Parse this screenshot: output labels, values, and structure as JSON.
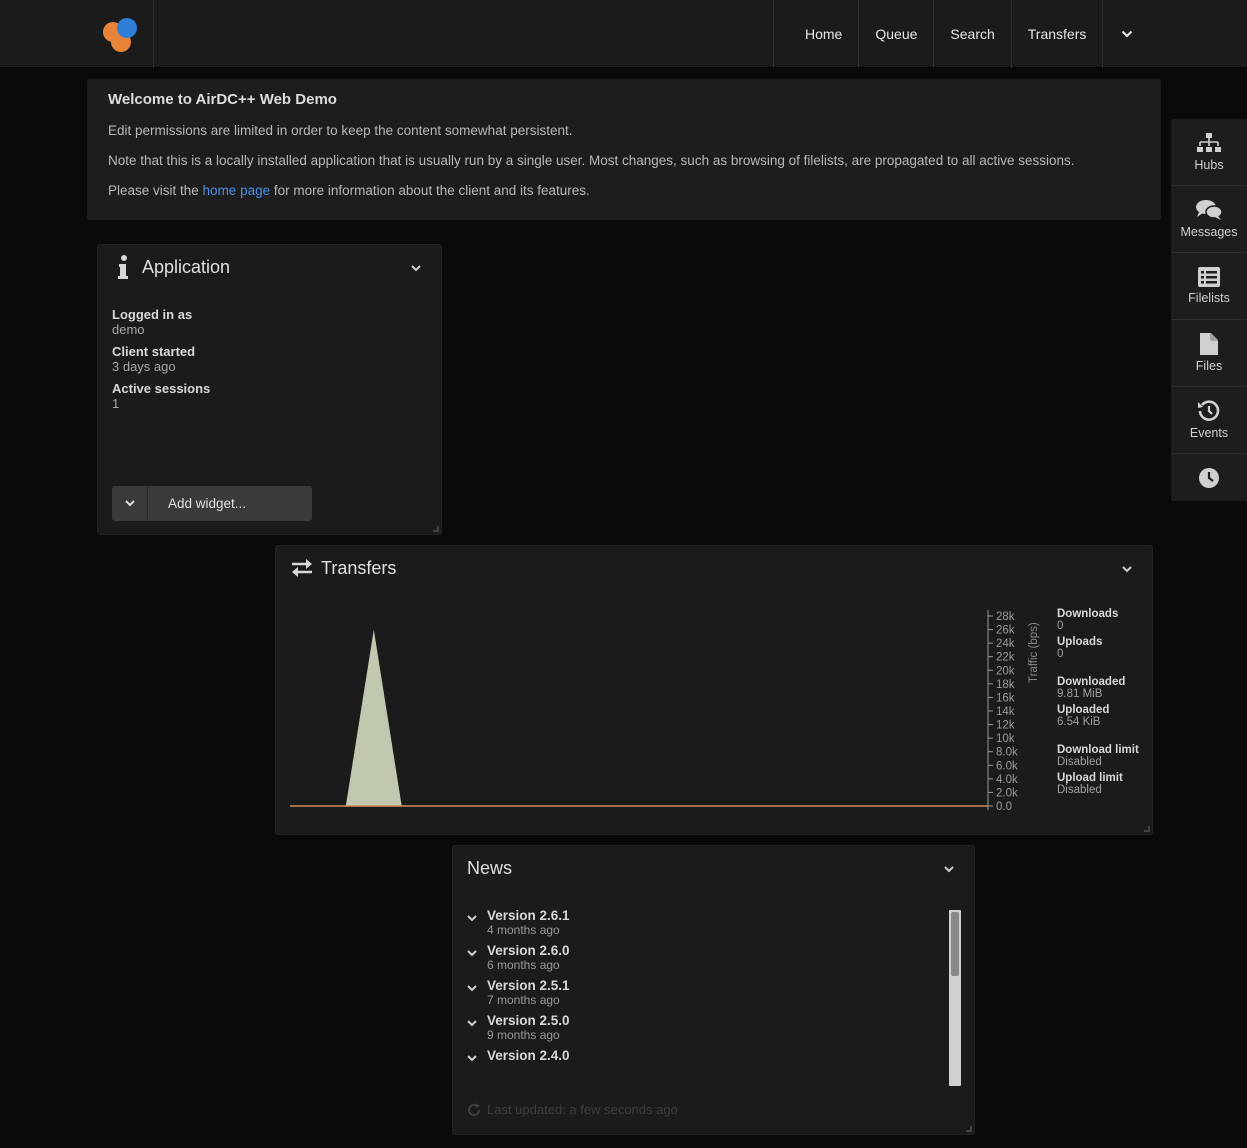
{
  "nav": {
    "items": [
      "Home",
      "Queue",
      "Search",
      "Transfers"
    ]
  },
  "welcome": {
    "title": "Welcome to AirDC++ Web Demo",
    "line1": "Edit permissions are limited in order to keep the content somewhat persistent.",
    "line2": "Note that this is a locally installed application that is usually run by a single user. Most changes, such as browsing of filelists, are propagated to all active sessions.",
    "line3_pre": "Please visit the ",
    "line3_link": "home page",
    "line3_post": " for more information about the client and its features."
  },
  "sidebar": {
    "items": [
      {
        "label": "Hubs",
        "icon": "sitemap-icon"
      },
      {
        "label": "Messages",
        "icon": "comments-icon"
      },
      {
        "label": "Filelists",
        "icon": "list-icon"
      },
      {
        "label": "Files",
        "icon": "file-icon"
      },
      {
        "label": "Events",
        "icon": "history-icon"
      },
      {
        "label": "",
        "icon": "clock-icon"
      }
    ]
  },
  "application": {
    "title": "Application",
    "logged_in_label": "Logged in as",
    "logged_in_value": "demo",
    "client_started_label": "Client started",
    "client_started_value": "3 days ago",
    "active_sessions_label": "Active sessions",
    "active_sessions_value": "1",
    "add_widget_label": "Add widget..."
  },
  "transfers": {
    "title": "Transfers",
    "stats": [
      {
        "label": "Downloads",
        "value": "0"
      },
      {
        "label": "Uploads",
        "value": "0"
      },
      {
        "label": "Downloaded",
        "value": "9.81 MiB"
      },
      {
        "label": "Uploaded",
        "value": "6.54 KiB"
      },
      {
        "label": "Download limit",
        "value": "Disabled"
      },
      {
        "label": "Upload limit",
        "value": "Disabled"
      }
    ]
  },
  "chart_data": {
    "type": "area",
    "ylabel": "Traffic (bps)",
    "ylim": [
      0,
      28000
    ],
    "yticks": [
      "0.0",
      "2.0k",
      "4.0k",
      "6.0k",
      "8.0k",
      "10k",
      "12k",
      "14k",
      "16k",
      "18k",
      "20k",
      "22k",
      "24k",
      "26k",
      "28k"
    ],
    "series": [
      {
        "values": [
          0,
          0,
          0,
          26000,
          0,
          0,
          0,
          0,
          0,
          0,
          0,
          0,
          0,
          0,
          0,
          0,
          0,
          0,
          0,
          0,
          0,
          0,
          0,
          0,
          0,
          0
        ],
        "color": "#c0c8b0"
      },
      {
        "values": [
          0,
          0,
          0,
          0,
          0,
          0,
          0,
          0,
          0,
          0,
          0,
          0,
          0,
          0,
          0,
          0,
          0,
          0,
          0,
          0,
          0,
          0,
          0,
          0,
          0,
          0
        ],
        "color": "#d08a60"
      }
    ]
  },
  "news": {
    "title": "News",
    "items": [
      {
        "title": "Version 2.6.1",
        "date": "4 months ago"
      },
      {
        "title": "Version 2.6.0",
        "date": "6 months ago"
      },
      {
        "title": "Version 2.5.1",
        "date": "7 months ago"
      },
      {
        "title": "Version 2.5.0",
        "date": "9 months ago"
      },
      {
        "title": "Version 2.4.0",
        "date": ""
      }
    ],
    "footer": "Last updated: a few seconds ago"
  }
}
